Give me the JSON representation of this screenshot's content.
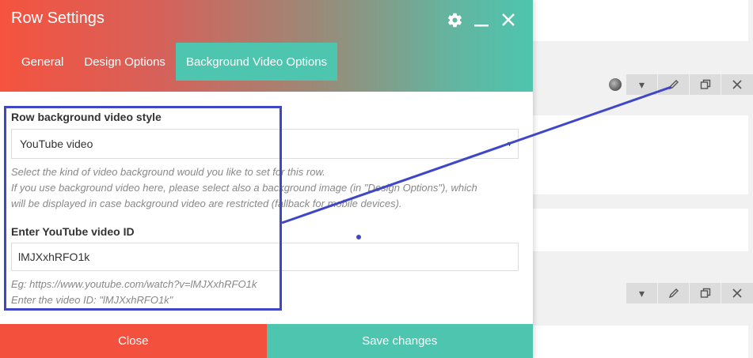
{
  "modal": {
    "title": "Row Settings",
    "tabs": [
      {
        "label": "General",
        "active": false
      },
      {
        "label": "Design Options",
        "active": false
      },
      {
        "label": "Background Video Options",
        "active": true
      }
    ],
    "fields": {
      "video_style": {
        "label": "Row background video style",
        "value": "YouTube video",
        "help_line1": "Select the kind of video background would you like to set for this row.",
        "help_line2": "If you use background video here, please select also a background image (in \"Design Options\"), which",
        "help_line3": "will be displayed in case background video are restricted (fallback for mobile devices)."
      },
      "youtube_id": {
        "label": "Enter YouTube video ID",
        "value": "lMJXxhRFO1k",
        "help_line1": "Eg: https://www.youtube.com/watch?v=lMJXxhRFO1k",
        "help_line2": "Enter the video ID: \"lMJXxhRFO1k\""
      }
    },
    "footer": {
      "close_label": "Close",
      "save_label": "Save changes"
    }
  },
  "icons": {
    "settings": "gear-icon",
    "minimize": "minimize-icon",
    "close": "close-icon",
    "row_dropdown": "chevron-down-icon",
    "row_edit": "pencil-icon",
    "row_clone": "copy-icon",
    "row_delete": "close-icon"
  },
  "colors": {
    "accent_teal": "#4ec5ae",
    "accent_red": "#f4503e",
    "annotation": "#3f47c8"
  }
}
